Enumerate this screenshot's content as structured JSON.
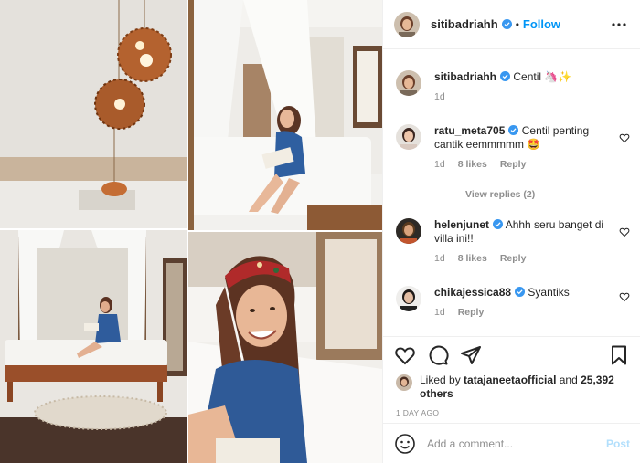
{
  "post": {
    "username": "sitibadriahh",
    "follow_label": "Follow",
    "separator": "•",
    "colors": {
      "accent": "#0095f6",
      "verified": "#3897f0",
      "muted": "#8e8e8e",
      "post_disabled": "#b2dffc"
    }
  },
  "caption": {
    "username": "sitibadriahh",
    "text": "Centil 🦄✨",
    "age": "1d"
  },
  "comments": [
    {
      "username": "ratu_meta705",
      "text": "Centil penting cantik eemmmmm 🤩",
      "age": "1d",
      "likes": "8 likes",
      "reply": "Reply"
    },
    {
      "username": "helenjunet",
      "text": "Ahhh seru banget di villa ini!!",
      "age": "1d",
      "likes": "8 likes",
      "reply": "Reply"
    },
    {
      "username": "chikajessica88",
      "text": "Syantiks",
      "age": "1d",
      "likes": "",
      "reply": "Reply"
    }
  ],
  "view_replies": "View replies (2)",
  "likes": {
    "prefix": "Liked by ",
    "user": "tatajaneetaofficial",
    "middle": " and ",
    "count": "25,392 others"
  },
  "time_ago": "1 DAY AGO",
  "add_comment": {
    "placeholder": "Add a comment...",
    "post_label": "Post"
  },
  "icons": [
    "more-icon",
    "heart-icon",
    "comment-icon",
    "share-icon",
    "bookmark-icon",
    "emoji-icon",
    "verified-icon"
  ]
}
